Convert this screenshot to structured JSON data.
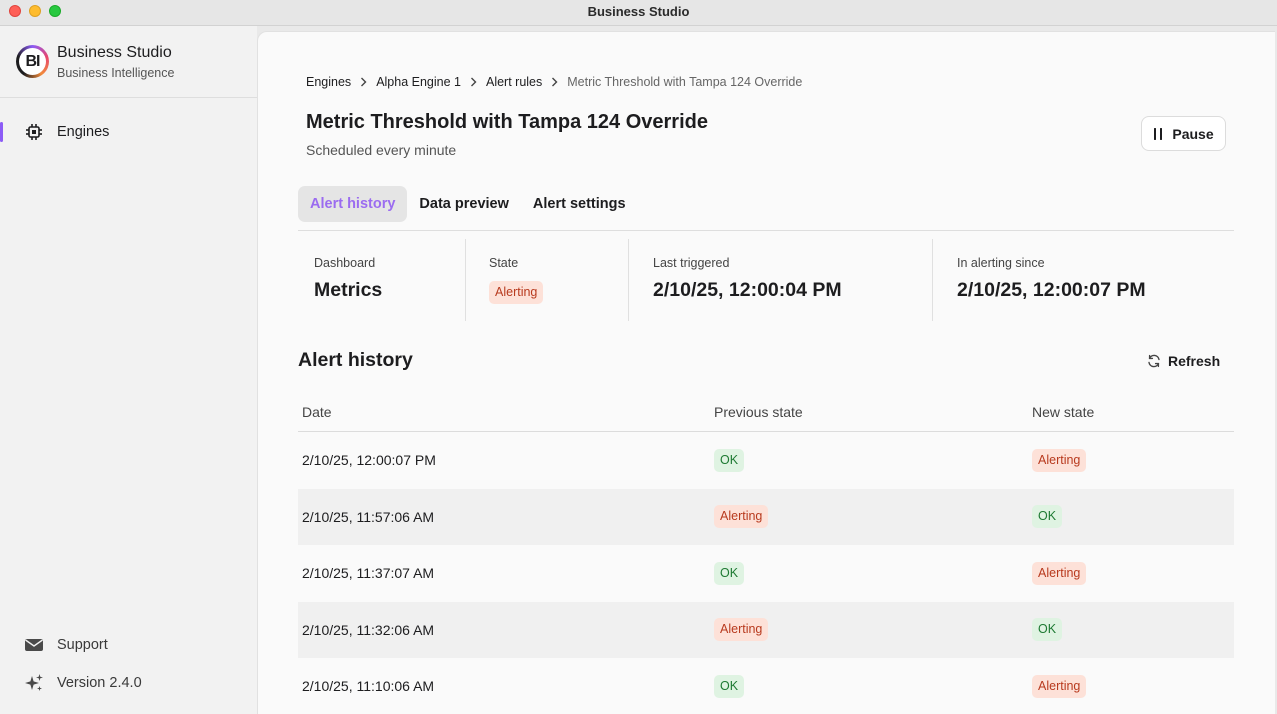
{
  "window": {
    "title": "Business Studio"
  },
  "brand": {
    "logo_text": "BI",
    "name": "Business Studio",
    "subtitle": "Business Intelligence"
  },
  "sidebar": {
    "items": [
      {
        "label": "Engines",
        "icon": "chip-icon",
        "active": true
      }
    ],
    "footer": [
      {
        "label": "Support",
        "icon": "envelope-icon"
      },
      {
        "label": "Version 2.4.0",
        "icon": "sparkles-icon"
      }
    ]
  },
  "breadcrumb": [
    "Engines",
    "Alpha Engine 1",
    "Alert rules",
    "Metric Threshold with Tampa 124 Override"
  ],
  "header": {
    "title": "Metric Threshold with Tampa 124 Override",
    "subtitle": "Scheduled every minute",
    "pause_label": "Pause"
  },
  "tabs": [
    {
      "label": "Alert history",
      "active": true
    },
    {
      "label": "Data preview",
      "active": false
    },
    {
      "label": "Alert settings",
      "active": false
    }
  ],
  "stats": {
    "dashboard": {
      "label": "Dashboard",
      "value": "Metrics"
    },
    "state": {
      "label": "State",
      "value": "Alerting"
    },
    "last_triggered": {
      "label": "Last triggered",
      "value": "2/10/25, 12:00:04 PM"
    },
    "alerting_since": {
      "label": "In alerting since",
      "value": "2/10/25, 12:00:07 PM"
    }
  },
  "history": {
    "title": "Alert history",
    "refresh_label": "Refresh",
    "columns": [
      "Date",
      "Previous state",
      "New state"
    ],
    "rows": [
      {
        "date": "2/10/25, 12:00:07 PM",
        "previous": "OK",
        "new": "Alerting"
      },
      {
        "date": "2/10/25, 11:57:06 AM",
        "previous": "Alerting",
        "new": "OK"
      },
      {
        "date": "2/10/25, 11:37:07 AM",
        "previous": "OK",
        "new": "Alerting"
      },
      {
        "date": "2/10/25, 11:32:06 AM",
        "previous": "Alerting",
        "new": "OK"
      },
      {
        "date": "2/10/25, 11:10:06 AM",
        "previous": "OK",
        "new": "Alerting"
      }
    ]
  },
  "colors": {
    "accent": "#8c5cf6",
    "alerting_bg": "#fde1d8",
    "alerting_fg": "#b83a1e",
    "ok_bg": "#dff3e2",
    "ok_fg": "#1e7a33"
  }
}
